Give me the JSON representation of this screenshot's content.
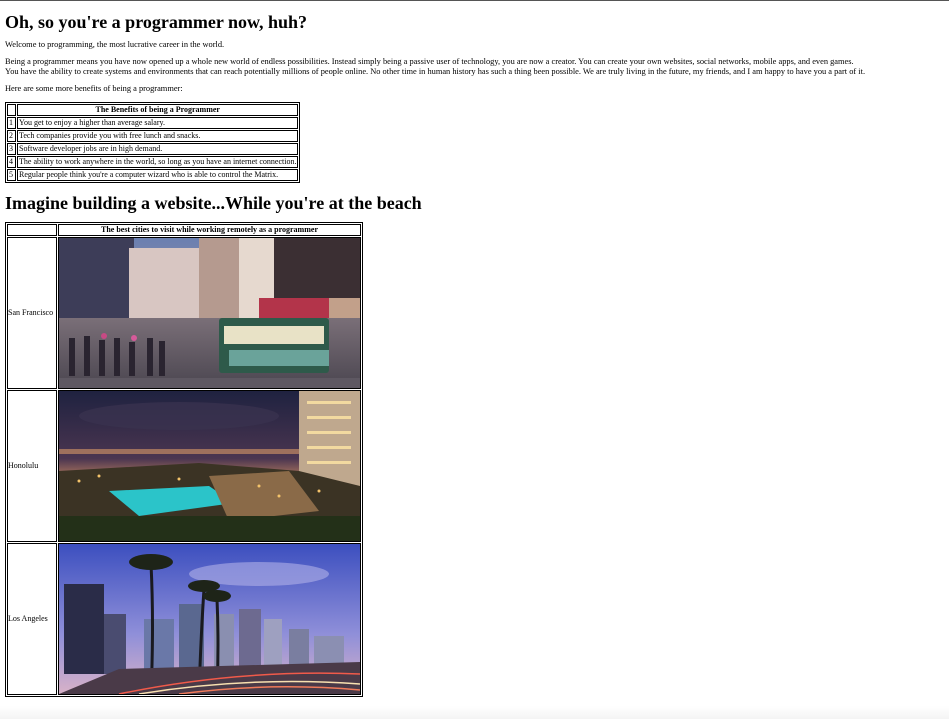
{
  "title": "Oh, so you're a programmer now, huh?",
  "intro": "Welcome to programming, the most lucrative career in the world.",
  "para1_line1": "Being a programmer means you have now opened up a whole new world of endless possibilities. Instead simply being a passive user of technology, you are now a creator. You can create your own websites, social networks, mobile apps, and even games.",
  "para1_line2": "You have the ability to create systems and environments that can reach potentially millions of people online. No other time in human history has such a thing been possible. We are truly living in the future, my friends, and I am happy to have you a part of it.",
  "more_benefits": "Here are some more benefits of being a programmer:",
  "benefits": {
    "header": "The Benefits of being a Programmer",
    "rows": [
      {
        "num": "1",
        "text": "You get to enjoy a higher than average salary."
      },
      {
        "num": "2",
        "text": "Tech companies provide you with free lunch and snacks."
      },
      {
        "num": "3",
        "text": "Software developer jobs are in high demand."
      },
      {
        "num": "4",
        "text": "The ability to work anywhere in the world, so long as you have an internet connection."
      },
      {
        "num": "5",
        "text": "Regular people think you're a computer wizard who is able to control the Matrix."
      }
    ]
  },
  "heading2": "Imagine building a website...While you're at the beach",
  "cities": {
    "header": "The best cities to visit while working remotely as a programmer",
    "rows": [
      {
        "name": "San Francisco",
        "image": "san-francisco-cable-car-photo"
      },
      {
        "name": "Honolulu",
        "image": "honolulu-pool-night-photo"
      },
      {
        "name": "Los Angeles",
        "image": "los-angeles-palm-skyline-photo"
      }
    ]
  }
}
